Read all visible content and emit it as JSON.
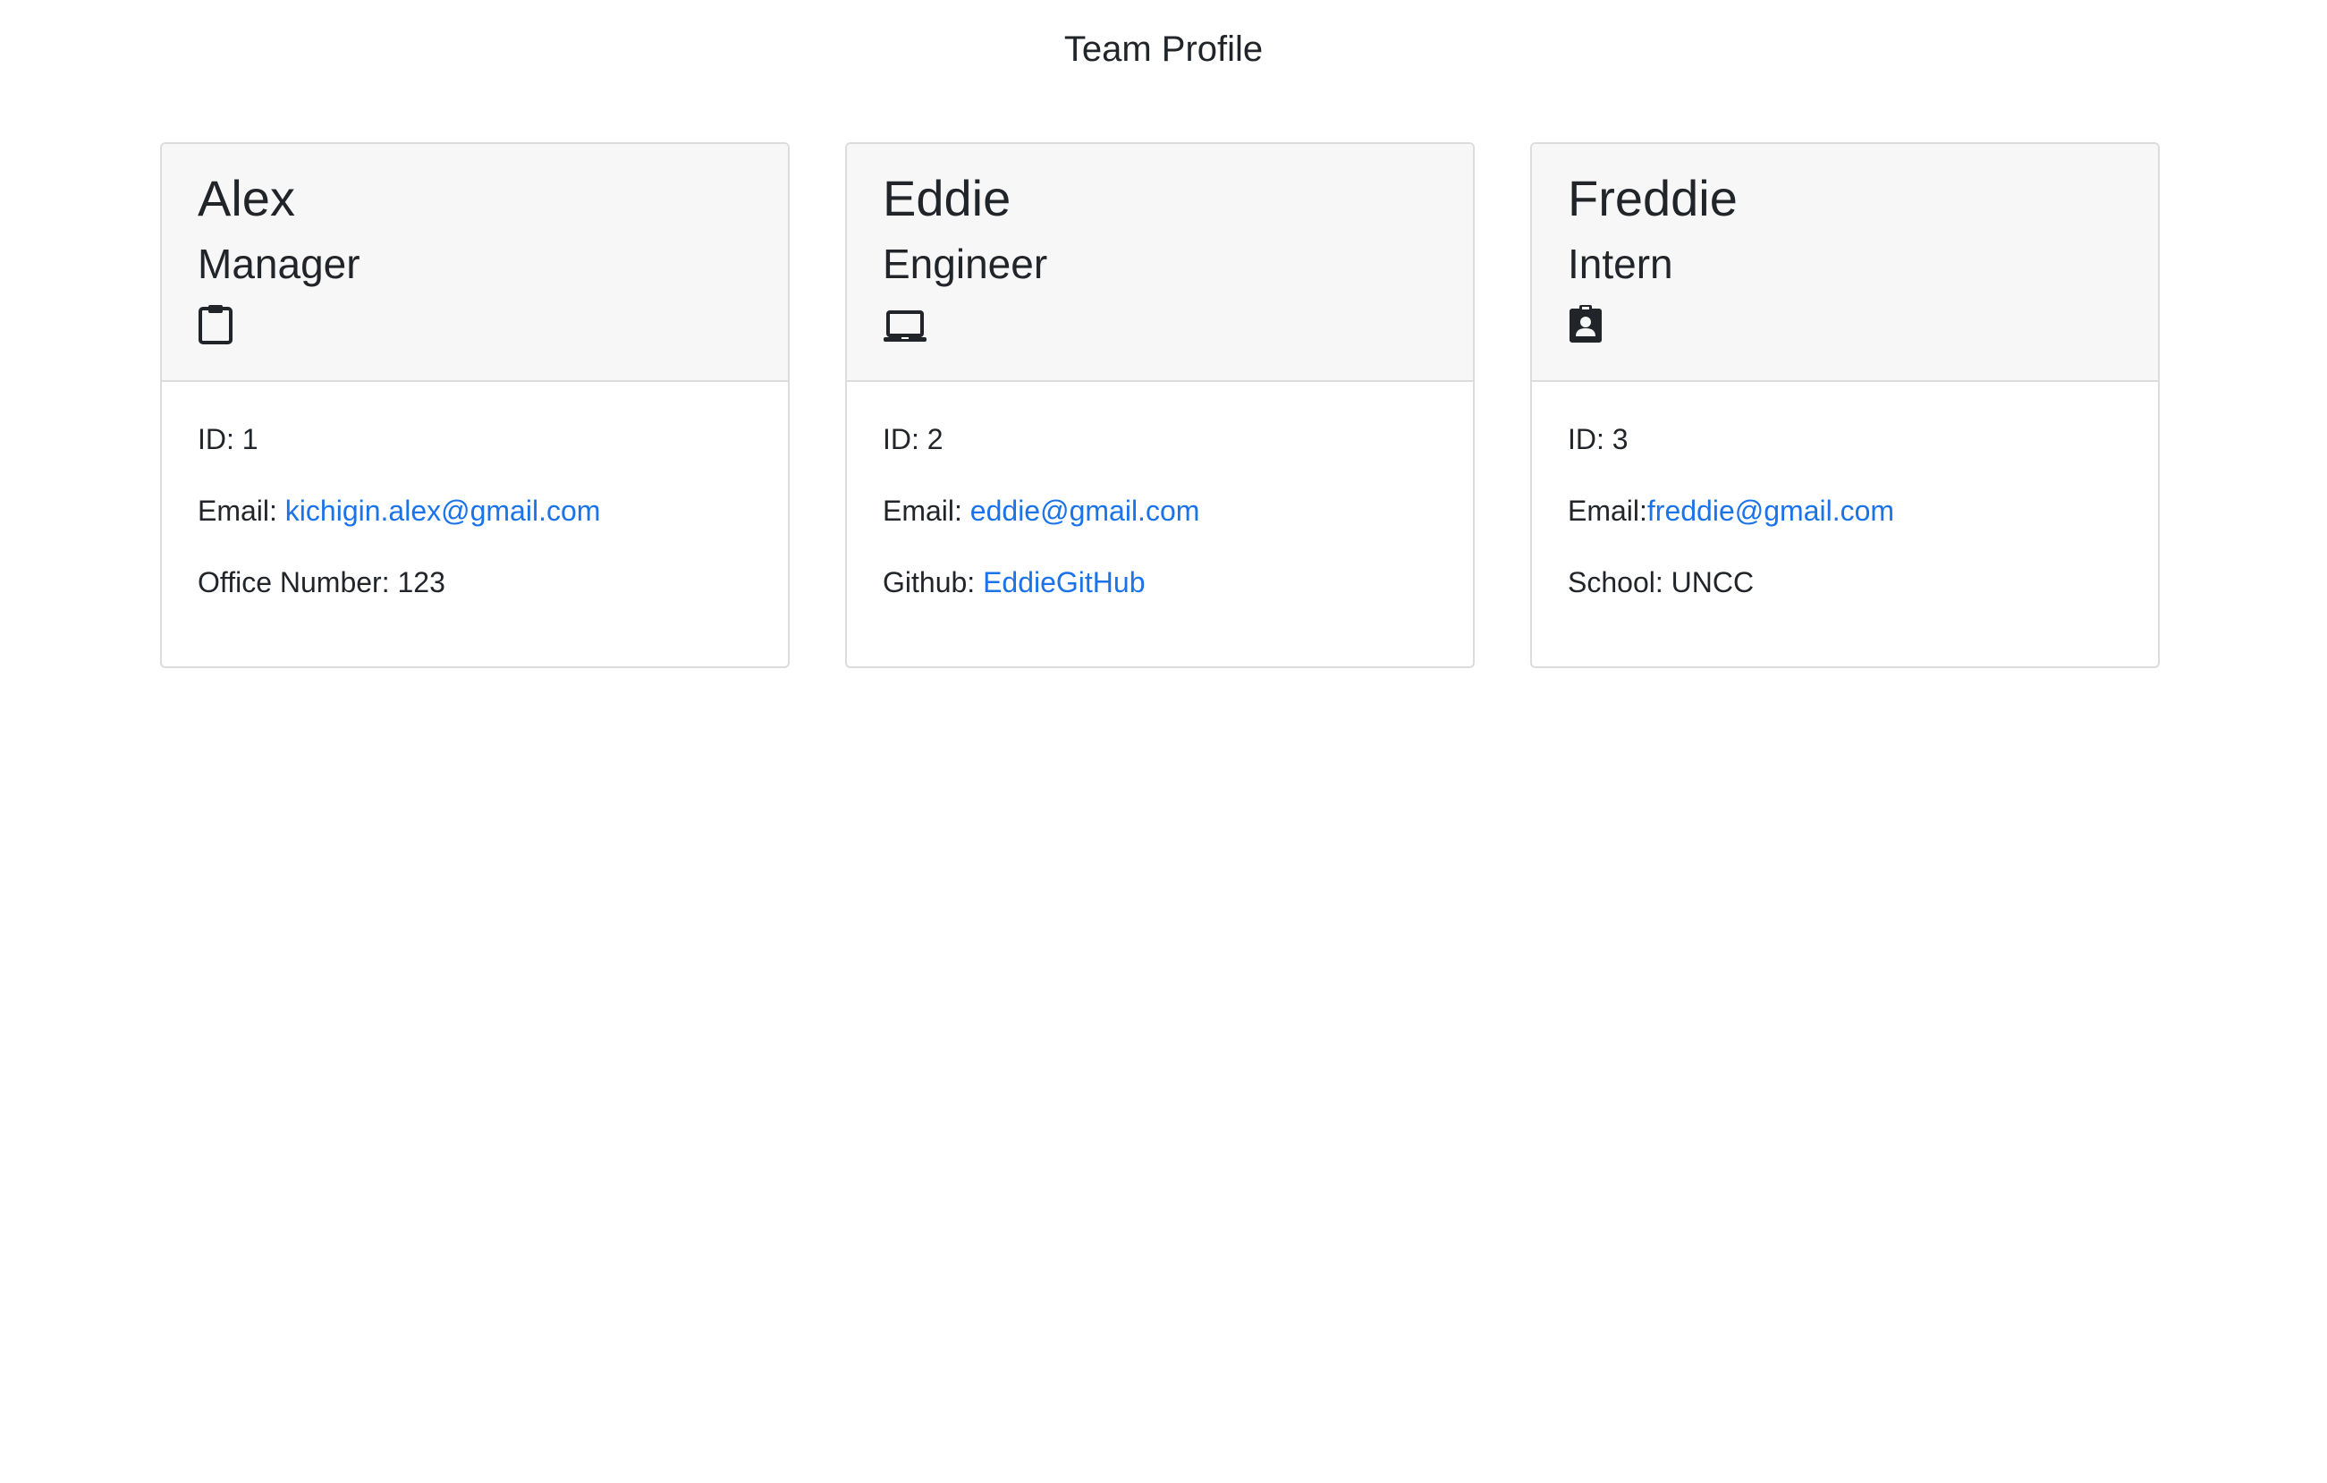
{
  "page": {
    "title": "Team Profile"
  },
  "colors": {
    "link": "#1a73e8",
    "header_bg": "#f7f7f7",
    "text": "#212529"
  },
  "cards": [
    {
      "name": "Alex",
      "role": "Manager",
      "icon": "clipboard-icon",
      "id_label": "ID: 1",
      "email_prefix": "Email: ",
      "email": "kichigin.alex@gmail.com",
      "extra_prefix": "Office Number: 123",
      "extra_value": ""
    },
    {
      "name": "Eddie",
      "role": "Engineer",
      "icon": "laptop-icon",
      "id_label": "ID: 2",
      "email_prefix": "Email: ",
      "email": "eddie@gmail.com",
      "extra_prefix": "Github: ",
      "extra_value": "EddieGitHub"
    },
    {
      "name": "Freddie",
      "role": "Intern",
      "icon": "id-badge-icon",
      "id_label": "ID: 3",
      "email_prefix": "Email:",
      "email": "freddie@gmail.com",
      "extra_prefix": "School: UNCC",
      "extra_value": ""
    }
  ]
}
